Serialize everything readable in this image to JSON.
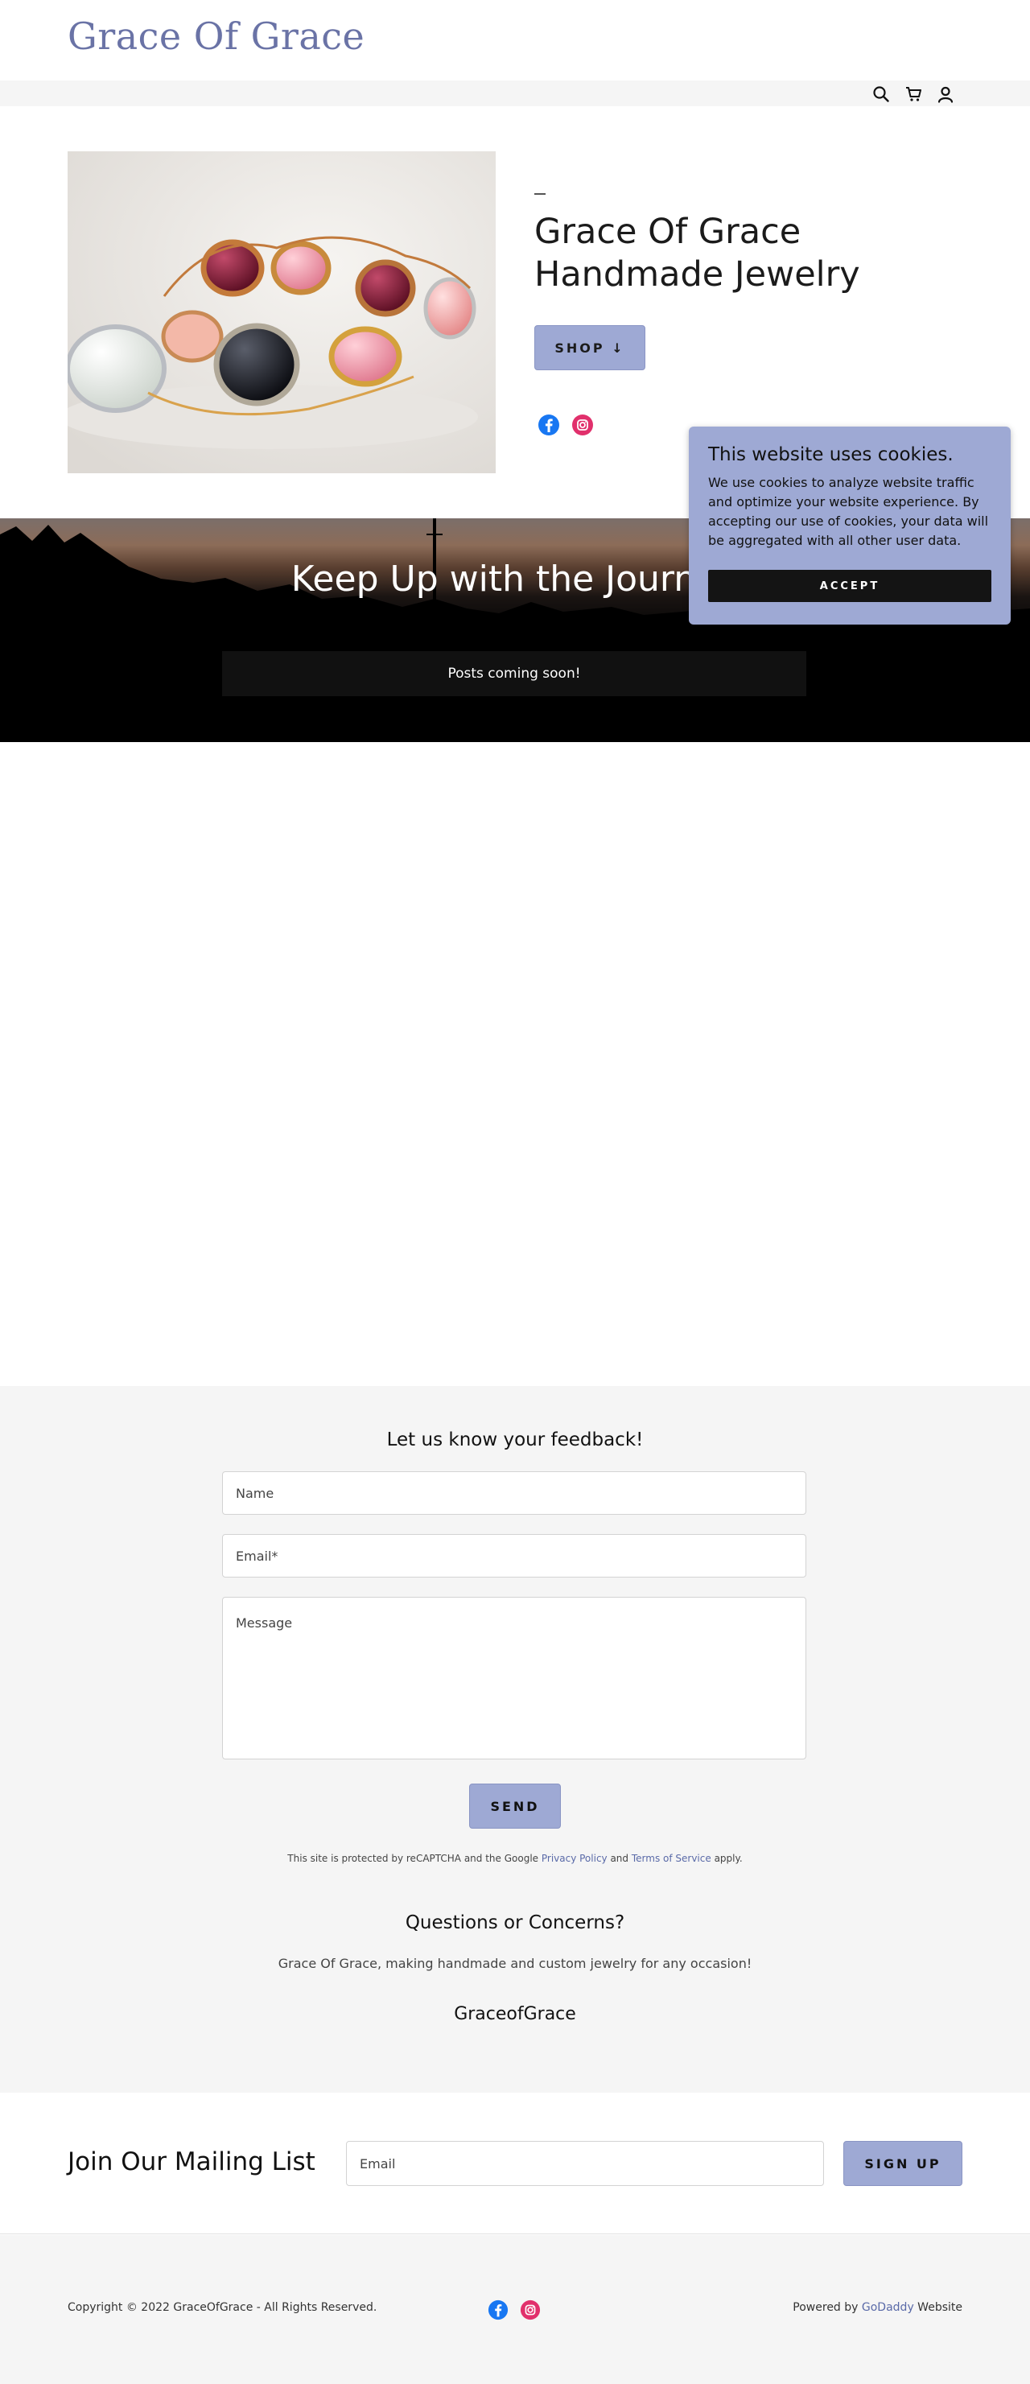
{
  "header": {
    "site_title": "Grace Of Grace"
  },
  "nav": {
    "icons": [
      "search-icon",
      "cart-icon",
      "account-icon"
    ]
  },
  "hero": {
    "title": "Grace Of Grace Handmade Jewelry",
    "shop_label": "SHOP ↓",
    "image_subject": "wire-wrapped gemstone rings"
  },
  "social": [
    "facebook-icon",
    "instagram-icon"
  ],
  "journey": {
    "title": "Keep Up with the Journey",
    "posts_text": "Posts coming soon!"
  },
  "cookie": {
    "title": "This website uses cookies.",
    "text": "We use cookies to analyze website traffic and optimize your website experience. By accepting our use of cookies, your data will be aggregated with all other user data.",
    "accept_label": "ACCEPT"
  },
  "feedback": {
    "heading": "Let us know your feedback!",
    "name_placeholder": "Name",
    "email_placeholder": "Email*",
    "message_placeholder": "Message",
    "send_label": "SEND",
    "recaptcha_prefix": "This site is protected by reCAPTCHA and the Google ",
    "privacy_label": "Privacy Policy",
    "and_text": " and ",
    "terms_label": "Terms of Service",
    "recaptcha_suffix": " apply.",
    "questions_heading": "Questions or Concerns?",
    "questions_text": "Grace Of Grace, making handmade and custom jewelry for any occasion!",
    "brand_name": "GraceofGrace"
  },
  "mailing": {
    "title": "Join Our Mailing List",
    "email_placeholder": "Email",
    "signup_label": "SIGN UP"
  },
  "footer": {
    "copyright": "Copyright © 2022 GraceOfGrace - All Rights Reserved.",
    "powered_prefix": "Powered by ",
    "powered_link": "GoDaddy",
    "powered_suffix": " Website"
  },
  "colors": {
    "accent": "#9ea9d4",
    "title": "#6a73a6",
    "facebook": "#1877f2",
    "instagram": "#e1306c"
  }
}
